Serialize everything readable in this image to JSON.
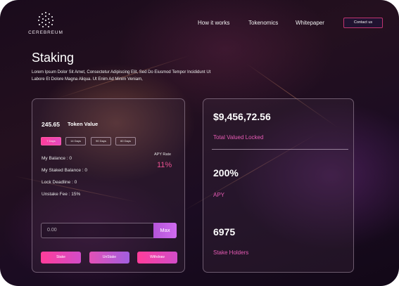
{
  "brand": {
    "name": "CEREBREUM"
  },
  "nav": {
    "items": [
      "How it works",
      "Tokenomics",
      "Whitepaper"
    ],
    "contact_label": "Contact us"
  },
  "page": {
    "title": "Staking",
    "description": "Lorem Ipsum Dolor Sit Amet, Consectetur Adipiscing Elit, Sed Do Eiusmod Tempor Incididunt Ut Labore Et Dolore Magna Aliqua. Ut Enim Ad Minim Veniam,"
  },
  "staking": {
    "token_value": "245.65",
    "token_label": "Token Value",
    "periods": [
      "7 Days",
      "14 Days",
      "90 Days",
      "60 Days"
    ],
    "active_period": "7 Days",
    "info": [
      "My Balance : 0",
      "My Staked Balance : 0",
      "Lock Deadline : 0",
      "Unstake Fee : 15%"
    ],
    "apy_label": "APY Rate",
    "apy_value": "11%",
    "amount_placeholder": "0.00",
    "max_label": "Max",
    "actions": [
      "Stake",
      "UnStake",
      "Withdraw"
    ]
  },
  "stats": {
    "total_locked_value": "$9,456,72.56",
    "total_locked_label": "Total Valued Locked",
    "apy_value": "200%",
    "apy_label": "APY",
    "holders_value": "6975",
    "holders_label": "Stake Holders"
  },
  "colors": {
    "accent_pink": "#ff3d9a",
    "accent_purple": "#b455d8",
    "label_pink": "#e75bb5"
  }
}
